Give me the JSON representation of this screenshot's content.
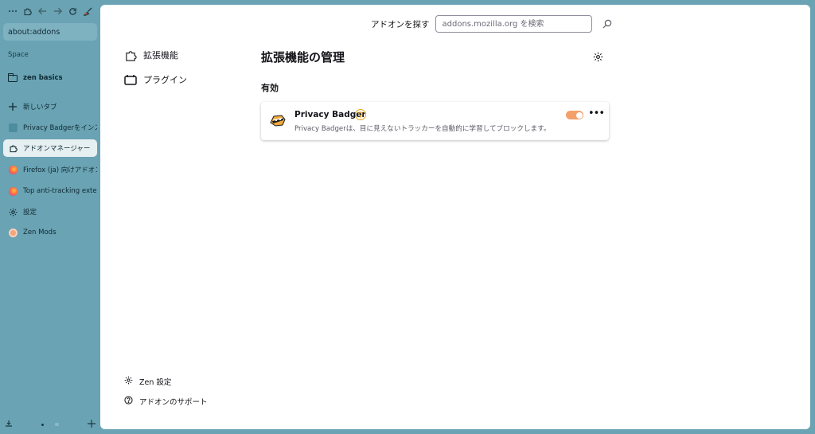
{
  "sidebar": {
    "toolbar": {
      "menu_icon": "more-dots-icon",
      "extensions_icon": "puzzle-icon",
      "back_icon": "back-arrow-icon",
      "forward_icon": "forward-arrow-icon",
      "reload_icon": "reload-icon",
      "pin_icon": "brush-icon"
    },
    "url": "about:addons",
    "space_label": "Space",
    "folder_label": "zen basics",
    "new_tab_label": "新しいタブ",
    "tabs": [
      {
        "label": "Privacy Badgerをインストール",
        "icon": "privacy-badger-favicon"
      },
      {
        "label": "アドオンマネージャー",
        "icon": "puzzle-icon",
        "active": true
      },
      {
        "label": "Firefox (ja) 向けアドオン",
        "icon": "firefox-icon"
      },
      {
        "label": "Top anti-tracking extensions",
        "icon": "firefox-icon"
      },
      {
        "label": "設定",
        "icon": "gear-icon"
      },
      {
        "label": "Zen Mods",
        "icon": "zen-icon"
      }
    ]
  },
  "header": {
    "search_label": "アドオンを探す",
    "search_placeholder": "addons.mozilla.org を検索"
  },
  "categories": [
    {
      "label": "拡張機能",
      "icon": "puzzle-icon",
      "selected": true
    },
    {
      "label": "プラグイン",
      "icon": "plugin-icon",
      "selected": false
    }
  ],
  "main": {
    "title": "拡張機能の管理",
    "section_title": "有効",
    "addon": {
      "name": "Privacy Badger",
      "description": "Privacy Badgerは、目に見えないトラッカーを自動的に学習してブロックします。",
      "enabled": true,
      "more_label": "•••"
    }
  },
  "footer": {
    "zen_settings": "Zen 設定",
    "support": "アドオンのサポート"
  },
  "colors": {
    "sidebar_bg": "#6aa3b3",
    "toggle_on": "#f4a06a",
    "badge": "#e8a31a"
  }
}
